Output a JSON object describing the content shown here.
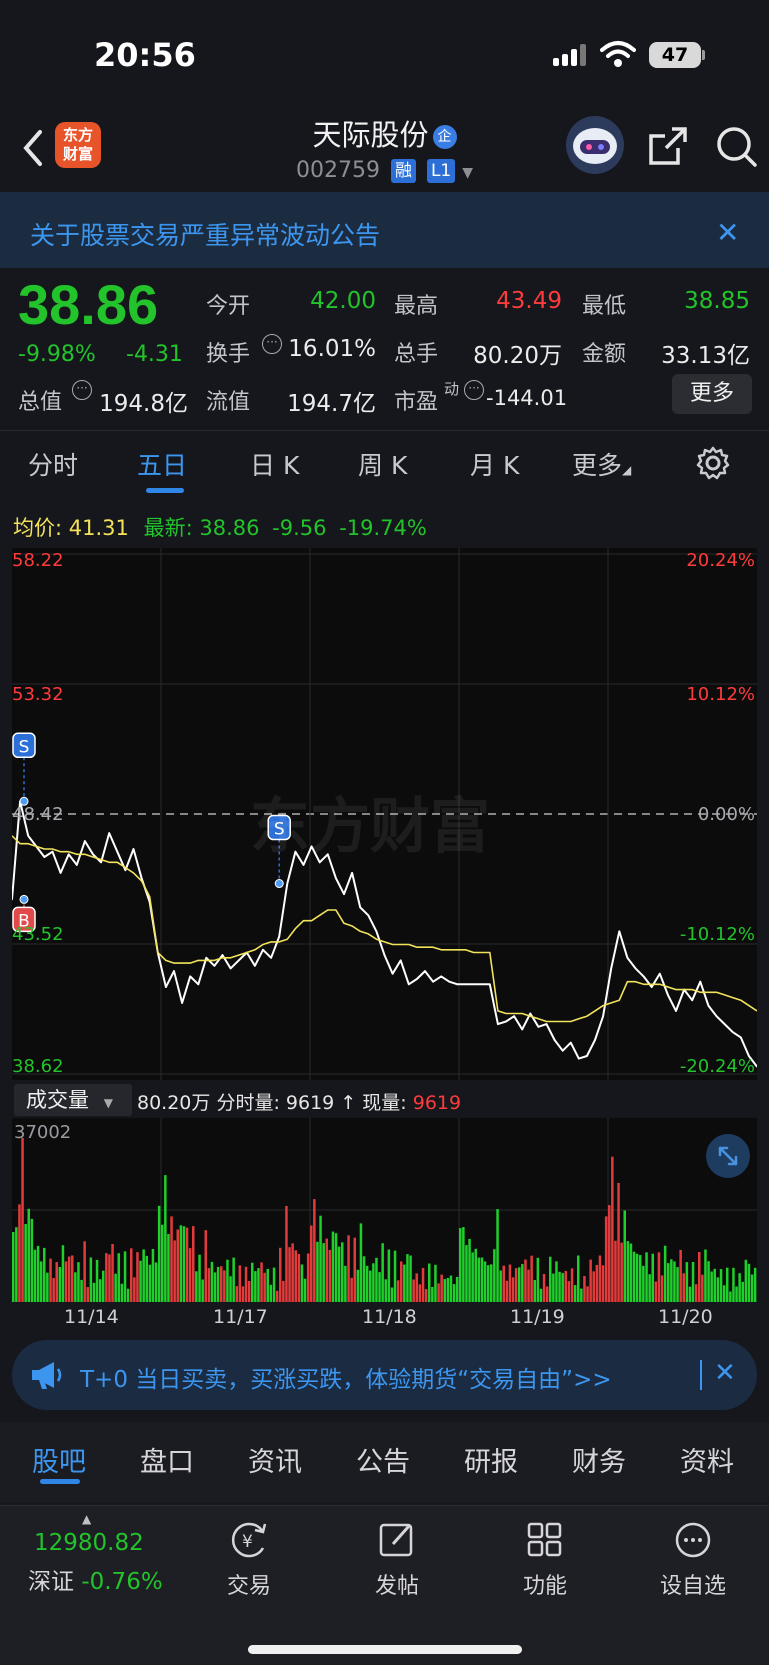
{
  "status": {
    "time": "20:56",
    "battery": "47"
  },
  "header": {
    "logo": "东方\n财富",
    "stock_name": "天际股份",
    "enterprise_badge": "企",
    "code": "002759",
    "tag_margin": "融",
    "tag_level": "L1"
  },
  "notice": {
    "text": "关于股票交易严重异常波动公告",
    "close": "✕"
  },
  "quote": {
    "price": "38.86",
    "pct": "-9.98%",
    "chg": "-4.31",
    "open_label": "今开",
    "open": "42.00",
    "high_label": "最高",
    "high": "43.49",
    "low_label": "最低",
    "low": "38.85",
    "turnover_label": "换手",
    "turnover": "16.01%",
    "volume_label": "总手",
    "volume": "80.20万",
    "amount_label": "金额",
    "amount": "33.13亿",
    "mcap_label": "总值",
    "mcap": "194.8亿",
    "float_label": "流值",
    "float": "194.7亿",
    "pe_label": "市盈",
    "pe_sup": "动",
    "pe": "-144.01",
    "more": "更多"
  },
  "period_tabs": [
    "分时",
    "五日",
    "日 K",
    "周 K",
    "月 K",
    "更多"
  ],
  "active_period": "五日",
  "summary": {
    "avg_label": "均价:",
    "avg": "41.31",
    "latest_label": "最新:",
    "latest": "38.86",
    "chg": "-9.56",
    "pct": "-19.74%"
  },
  "chart_data": {
    "type": "line",
    "title": "",
    "x_labels": [
      "11/14",
      "11/17",
      "11/18",
      "11/19",
      "11/20"
    ],
    "y_left_ticks": [
      "58.22",
      "53.32",
      "48.42",
      "43.52",
      "38.62"
    ],
    "y_right_ticks": [
      "20.24%",
      "10.12%",
      "0.00%",
      "-10.12%",
      "-20.24%"
    ],
    "ylim": [
      38.62,
      58.22
    ],
    "reference": 48.42,
    "series": [
      {
        "values": [
          45.2,
          48.9,
          47.6,
          47.2,
          46.8,
          47.0,
          46.2,
          46.9,
          46.5,
          47.4,
          46.9,
          46.6,
          47.7,
          47.0,
          46.3,
          47.1,
          46.0,
          45.1,
          43.2,
          41.9,
          42.5,
          41.3,
          42.3,
          42.0,
          43.0,
          42.7,
          43.1,
          42.6,
          42.9,
          43.2,
          42.7,
          43.3,
          43.0,
          43.8,
          45.8,
          47.0,
          46.5,
          47.2,
          46.6,
          46.9,
          46.0,
          45.4,
          46.2,
          44.9,
          44.6,
          44.0,
          43.1,
          42.4,
          42.9,
          42.0,
          42.2,
          42.5,
          42.1,
          42.3,
          42.1,
          42.0,
          42.0,
          42.0,
          42.0,
          42.0,
          40.5,
          40.6,
          40.8,
          40.3,
          40.9,
          40.4,
          40.5,
          39.9,
          39.5,
          39.8,
          39.2,
          39.3,
          39.9,
          40.8,
          42.6,
          44.0,
          43.0,
          42.6,
          42.3,
          41.9,
          42.4,
          41.6,
          41.0,
          41.8,
          41.4,
          42.1,
          41.2,
          40.8,
          40.5,
          40.2,
          40.0,
          39.3,
          38.9
        ],
        "line_color": "#ffffff"
      },
      {
        "values": [
          47.6,
          47.3,
          47.3,
          47.2,
          47.1,
          47.1,
          47.0,
          47.0,
          46.9,
          46.9,
          46.8,
          46.7,
          46.6,
          46.6,
          46.4,
          46.2,
          45.9,
          45.3,
          43.2,
          42.9,
          42.8,
          42.8,
          42.8,
          42.9,
          42.9,
          42.9,
          43.0,
          43.0,
          43.1,
          43.2,
          43.3,
          43.5,
          43.6,
          43.6,
          43.7,
          44.1,
          44.4,
          44.4,
          44.6,
          44.8,
          44.8,
          44.3,
          44.2,
          44.0,
          43.9,
          43.7,
          43.6,
          43.5,
          43.5,
          43.5,
          43.4,
          43.4,
          43.4,
          43.3,
          43.3,
          43.3,
          43.3,
          43.2,
          43.2,
          43.2,
          41.0,
          40.9,
          40.9,
          40.9,
          40.8,
          40.7,
          40.6,
          40.6,
          40.6,
          40.6,
          40.7,
          40.8,
          41.0,
          41.2,
          41.3,
          41.4,
          42.1,
          42.1,
          42.0,
          42.0,
          42.0,
          41.9,
          41.8,
          41.8,
          41.8,
          41.7,
          41.7,
          41.7,
          41.6,
          41.5,
          41.4,
          41.2,
          41.0
        ],
        "line_color": "#f3e35a"
      }
    ],
    "markers": [
      {
        "label": "S"
      },
      {
        "label": "S"
      },
      {
        "label": "B"
      }
    ]
  },
  "volume": {
    "selector": "成交量",
    "total": "80.20万",
    "interval_label": "分时量:",
    "interval": "9619",
    "arrow": "↑",
    "current_label": "现量:",
    "current": "9619",
    "max_tick": "37002"
  },
  "banner": {
    "text": "T+0 当日买卖，买涨买跌，体验期货“交易自由”>>",
    "close": "✕"
  },
  "bottom_tabs": [
    "股吧",
    "盘口",
    "资讯",
    "公告",
    "研报",
    "财务",
    "资料"
  ],
  "active_bottom_tab": "股吧",
  "dock": {
    "index_value": "12980.82",
    "index_name": "深证",
    "index_pct": "-0.76%",
    "items": [
      "交易",
      "发帖",
      "功能",
      "设自选"
    ]
  }
}
